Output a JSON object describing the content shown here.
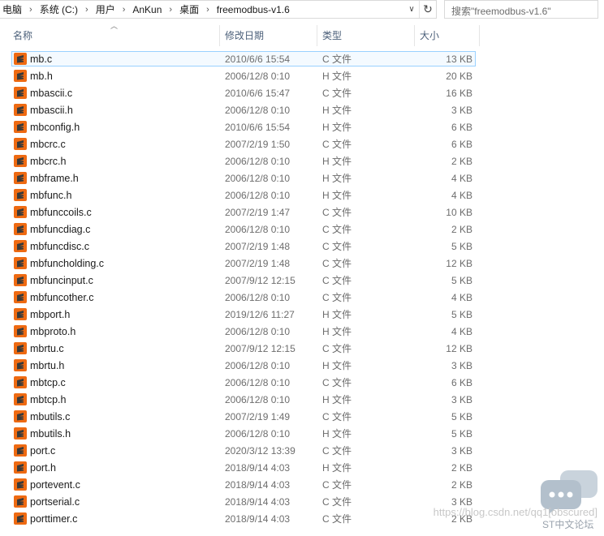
{
  "address_bar": {
    "crumbs": [
      "电脑",
      "系统 (C:)",
      "用户",
      "AnKun",
      "桌面",
      "freemodbus-v1.6"
    ]
  },
  "search": {
    "placeholder": "搜索\"freemodbus-v1.6\""
  },
  "columns": {
    "name": "名称",
    "date": "修改日期",
    "type": "类型",
    "size": "大小"
  },
  "files": [
    {
      "name": "mb.c",
      "date": "2010/6/6 15:54",
      "type": "C 文件",
      "size": "13 KB"
    },
    {
      "name": "mb.h",
      "date": "2006/12/8 0:10",
      "type": "H 文件",
      "size": "20 KB"
    },
    {
      "name": "mbascii.c",
      "date": "2010/6/6 15:47",
      "type": "C 文件",
      "size": "16 KB"
    },
    {
      "name": "mbascii.h",
      "date": "2006/12/8 0:10",
      "type": "H 文件",
      "size": "3 KB"
    },
    {
      "name": "mbconfig.h",
      "date": "2010/6/6 15:54",
      "type": "H 文件",
      "size": "6 KB"
    },
    {
      "name": "mbcrc.c",
      "date": "2007/2/19 1:50",
      "type": "C 文件",
      "size": "6 KB"
    },
    {
      "name": "mbcrc.h",
      "date": "2006/12/8 0:10",
      "type": "H 文件",
      "size": "2 KB"
    },
    {
      "name": "mbframe.h",
      "date": "2006/12/8 0:10",
      "type": "H 文件",
      "size": "4 KB"
    },
    {
      "name": "mbfunc.h",
      "date": "2006/12/8 0:10",
      "type": "H 文件",
      "size": "4 KB"
    },
    {
      "name": "mbfunccoils.c",
      "date": "2007/2/19 1:47",
      "type": "C 文件",
      "size": "10 KB"
    },
    {
      "name": "mbfuncdiag.c",
      "date": "2006/12/8 0:10",
      "type": "C 文件",
      "size": "2 KB"
    },
    {
      "name": "mbfuncdisc.c",
      "date": "2007/2/19 1:48",
      "type": "C 文件",
      "size": "5 KB"
    },
    {
      "name": "mbfuncholding.c",
      "date": "2007/2/19 1:48",
      "type": "C 文件",
      "size": "12 KB"
    },
    {
      "name": "mbfuncinput.c",
      "date": "2007/9/12 12:15",
      "type": "C 文件",
      "size": "5 KB"
    },
    {
      "name": "mbfuncother.c",
      "date": "2006/12/8 0:10",
      "type": "C 文件",
      "size": "4 KB"
    },
    {
      "name": "mbport.h",
      "date": "2019/12/6 11:27",
      "type": "H 文件",
      "size": "5 KB"
    },
    {
      "name": "mbproto.h",
      "date": "2006/12/8 0:10",
      "type": "H 文件",
      "size": "4 KB"
    },
    {
      "name": "mbrtu.c",
      "date": "2007/9/12 12:15",
      "type": "C 文件",
      "size": "12 KB"
    },
    {
      "name": "mbrtu.h",
      "date": "2006/12/8 0:10",
      "type": "H 文件",
      "size": "3 KB"
    },
    {
      "name": "mbtcp.c",
      "date": "2006/12/8 0:10",
      "type": "C 文件",
      "size": "6 KB"
    },
    {
      "name": "mbtcp.h",
      "date": "2006/12/8 0:10",
      "type": "H 文件",
      "size": "3 KB"
    },
    {
      "name": "mbutils.c",
      "date": "2007/2/19 1:49",
      "type": "C 文件",
      "size": "5 KB"
    },
    {
      "name": "mbutils.h",
      "date": "2006/12/8 0:10",
      "type": "H 文件",
      "size": "5 KB"
    },
    {
      "name": "port.c",
      "date": "2020/3/12 13:39",
      "type": "C 文件",
      "size": "3 KB"
    },
    {
      "name": "port.h",
      "date": "2018/9/14 4:03",
      "type": "H 文件",
      "size": "2 KB"
    },
    {
      "name": "portevent.c",
      "date": "2018/9/14 4:03",
      "type": "C 文件",
      "size": "2 KB"
    },
    {
      "name": "portserial.c",
      "date": "2018/9/14 4:03",
      "type": "C 文件",
      "size": "3 KB"
    },
    {
      "name": "porttimer.c",
      "date": "2018/9/14 4:03",
      "type": "C 文件",
      "size": "2 KB"
    }
  ],
  "selected_index": 0,
  "file_icon": "sublime-text-icon",
  "colors": {
    "icon_orange": "#ee6a12",
    "selection_border": "#99d1ff",
    "header_text": "#4c607a"
  },
  "watermark": {
    "url": "https://blog.csdn.net/qq1[obscured]",
    "label": "ST中文论坛"
  }
}
